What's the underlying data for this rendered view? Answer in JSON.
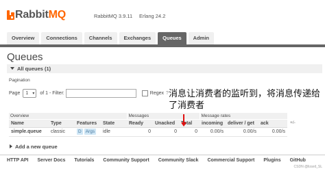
{
  "app": {
    "logo_rabbit": "Rabbit",
    "logo_mq": "MQ",
    "rabbitmq_version": "RabbitMQ 3.9.11",
    "erlang_version": "Erlang 24.2"
  },
  "nav": {
    "tabs": [
      {
        "label": "Overview"
      },
      {
        "label": "Connections"
      },
      {
        "label": "Channels"
      },
      {
        "label": "Exchanges"
      },
      {
        "label": "Queues"
      },
      {
        "label": "Admin"
      }
    ]
  },
  "page": {
    "title": "Queues",
    "section": "All queues (1)",
    "pagination_label": "Pagination",
    "page_label": "Page",
    "page_value": "1",
    "of_label": "of 1 - Filter:",
    "filter_value": "",
    "regex_label": "Regex",
    "regex_help": "?",
    "add_queue": "Add a new queue"
  },
  "table": {
    "groups": {
      "overview": "Overview",
      "messages": "Messages",
      "rates": "Message rates"
    },
    "plus_help": "+/-",
    "headers": {
      "name": "Name",
      "type": "Type",
      "features": "Features",
      "state": "State",
      "ready": "Ready",
      "unacked": "Unacked",
      "total": "Total",
      "incoming": "incoming",
      "deliver_get": "deliver / get",
      "ack": "ack"
    },
    "rows": [
      {
        "name": "simple.queue",
        "type": "classic",
        "feature_d": "D",
        "feature_args": "Args",
        "state": "idle",
        "ready": "0",
        "unacked": "0",
        "total": "0",
        "incoming": "0.00/s",
        "deliver_get": "0.00/s",
        "ack": "0.00/s"
      }
    ]
  },
  "annotation": {
    "text": "消息让消费者的监听到，将消息传递给了消费者",
    "color": "#e01010"
  },
  "footer": {
    "links": [
      {
        "label": "HTTP API"
      },
      {
        "label": "Server Docs"
      },
      {
        "label": "Tutorials"
      },
      {
        "label": "Community Support"
      },
      {
        "label": "Community Slack"
      },
      {
        "label": "Commercial Support"
      },
      {
        "label": "Plugins"
      },
      {
        "label": "GitHub"
      }
    ],
    "watermark": "CSDN @lizard_SL"
  },
  "colors": {
    "brand": "#ff6600",
    "nav_active": "#666666",
    "header_bg": "#f0f0f0"
  }
}
